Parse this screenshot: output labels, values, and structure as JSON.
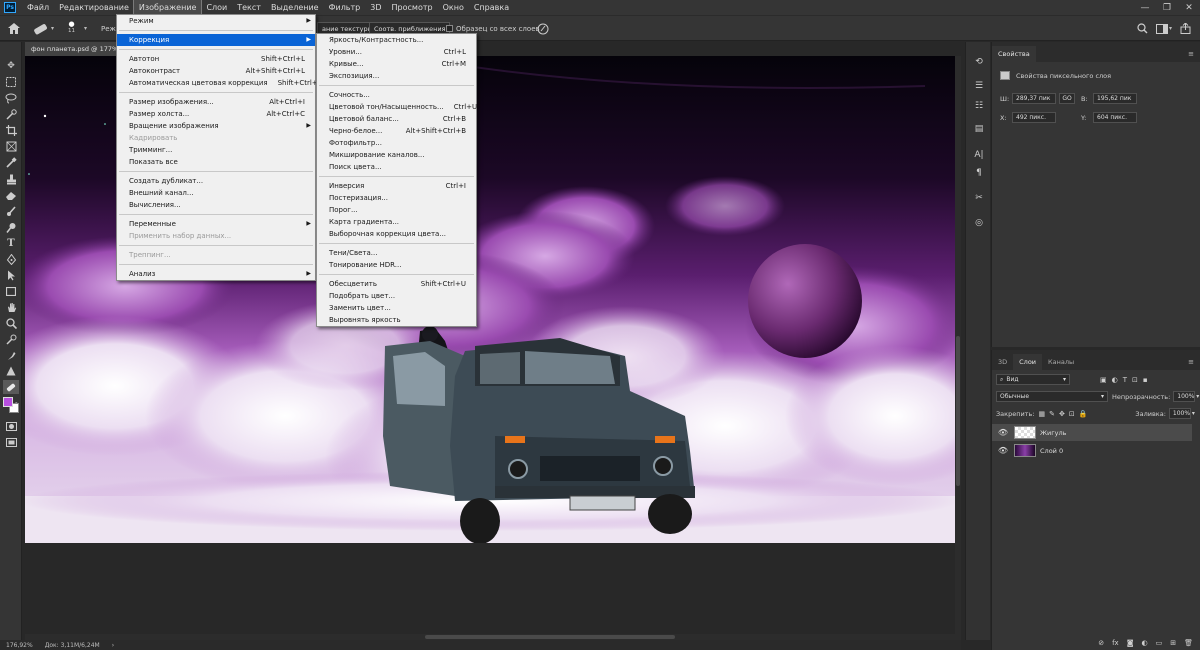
{
  "menubar": {
    "items": [
      "Файл",
      "Редактирование",
      "Изображение",
      "Слои",
      "Текст",
      "Выделение",
      "Фильтр",
      "3D",
      "Просмотр",
      "Окно",
      "Справка"
    ],
    "active_index": 2
  },
  "options_bar": {
    "brush_size": "11",
    "mode_label_partial": "Реж",
    "texture_button": "ание текстуры",
    "proximity_button": "Соотв. приближения",
    "sample_all_layers": "Образец со всех слоев"
  },
  "document_tab": {
    "title": "фон планета.psd @ 177%"
  },
  "status_bar": {
    "zoom": "176,92%",
    "doc_size": "Док: 3,11M/6,24M"
  },
  "image_menu": {
    "items": [
      {
        "label": "Режим",
        "shortcut": "",
        "submenu": true,
        "state": "normal"
      },
      {
        "sep": true
      },
      {
        "label": "Коррекция",
        "shortcut": "",
        "submenu": true,
        "state": "highlight"
      },
      {
        "sep": true
      },
      {
        "label": "Автотон",
        "shortcut": "Shift+Ctrl+L",
        "state": "normal"
      },
      {
        "label": "Автоконтраст",
        "shortcut": "Alt+Shift+Ctrl+L",
        "state": "normal"
      },
      {
        "label": "Автоматическая цветовая коррекция",
        "shortcut": "Shift+Ctrl+B",
        "state": "normal"
      },
      {
        "sep": true
      },
      {
        "label": "Размер изображения...",
        "shortcut": "Alt+Ctrl+I",
        "state": "normal"
      },
      {
        "label": "Размер холста...",
        "shortcut": "Alt+Ctrl+C",
        "state": "normal"
      },
      {
        "label": "Вращение изображения",
        "shortcut": "",
        "submenu": true,
        "state": "normal"
      },
      {
        "label": "Кадрировать",
        "shortcut": "",
        "state": "disabled"
      },
      {
        "label": "Тримминг...",
        "shortcut": "",
        "state": "normal"
      },
      {
        "label": "Показать все",
        "shortcut": "",
        "state": "normal"
      },
      {
        "sep": true
      },
      {
        "label": "Создать дубликат...",
        "shortcut": "",
        "state": "normal"
      },
      {
        "label": "Внешний канал...",
        "shortcut": "",
        "state": "normal"
      },
      {
        "label": "Вычисления...",
        "shortcut": "",
        "state": "normal"
      },
      {
        "sep": true
      },
      {
        "label": "Переменные",
        "shortcut": "",
        "submenu": true,
        "state": "normal"
      },
      {
        "label": "Применить набор данных...",
        "shortcut": "",
        "state": "disabled"
      },
      {
        "sep": true
      },
      {
        "label": "Треппинг...",
        "shortcut": "",
        "state": "disabled"
      },
      {
        "sep": true
      },
      {
        "label": "Анализ",
        "shortcut": "",
        "submenu": true,
        "state": "normal"
      }
    ]
  },
  "correction_menu": {
    "items": [
      {
        "label": "Яркость/Контрастность...",
        "shortcut": ""
      },
      {
        "label": "Уровни...",
        "shortcut": "Ctrl+L"
      },
      {
        "label": "Кривые...",
        "shortcut": "Ctrl+M"
      },
      {
        "label": "Экспозиция...",
        "shortcut": ""
      },
      {
        "sep": true
      },
      {
        "label": "Сочность...",
        "shortcut": ""
      },
      {
        "label": "Цветовой тон/Насыщенность...",
        "shortcut": "Ctrl+U"
      },
      {
        "label": "Цветовой баланс...",
        "shortcut": "Ctrl+B"
      },
      {
        "label": "Черно-белое...",
        "shortcut": "Alt+Shift+Ctrl+B"
      },
      {
        "label": "Фотофильтр...",
        "shortcut": ""
      },
      {
        "label": "Микширование каналов...",
        "shortcut": ""
      },
      {
        "label": "Поиск цвета...",
        "shortcut": ""
      },
      {
        "sep": true
      },
      {
        "label": "Инверсия",
        "shortcut": "Ctrl+I"
      },
      {
        "label": "Постеризация...",
        "shortcut": ""
      },
      {
        "label": "Порог...",
        "shortcut": ""
      },
      {
        "label": "Карта градиента...",
        "shortcut": ""
      },
      {
        "label": "Выборочная коррекция цвета...",
        "shortcut": ""
      },
      {
        "sep": true
      },
      {
        "label": "Тени/Света...",
        "shortcut": ""
      },
      {
        "label": "Тонирование HDR...",
        "shortcut": ""
      },
      {
        "sep": true
      },
      {
        "label": "Обесцветить",
        "shortcut": "Shift+Ctrl+U"
      },
      {
        "label": "Подобрать цвет...",
        "shortcut": ""
      },
      {
        "label": "Заменить цвет...",
        "shortcut": ""
      },
      {
        "label": "Выровнять яркость",
        "shortcut": ""
      }
    ]
  },
  "properties_panel": {
    "tab": "Свойства",
    "subtitle": "Свойства пиксельного слоя",
    "w_label": "Ш:",
    "w_value": "289,37 пик",
    "link": "GO",
    "h_label": "В:",
    "h_value": "195,62 пик",
    "x_label": "X:",
    "x_value": "492 пикс.",
    "y_label": "Y:",
    "y_value": "604 пикс."
  },
  "layers_panel": {
    "tabs": [
      "3D",
      "Слои",
      "Каналы"
    ],
    "active_tab": 1,
    "filter_label": "Вид",
    "blend_mode": "Обычные",
    "opacity_label": "Непрозрачность:",
    "opacity_value": "100%",
    "lock_label": "Закрепить:",
    "fill_label": "Заливка:",
    "fill_value": "100%",
    "layers": [
      {
        "name": "Жигуль",
        "selected": true
      },
      {
        "name": "Слой 0",
        "selected": false
      }
    ]
  },
  "colors": {
    "foreground": "#b84fe0",
    "background": "#ffffff",
    "highlight": "#0a64d6"
  }
}
